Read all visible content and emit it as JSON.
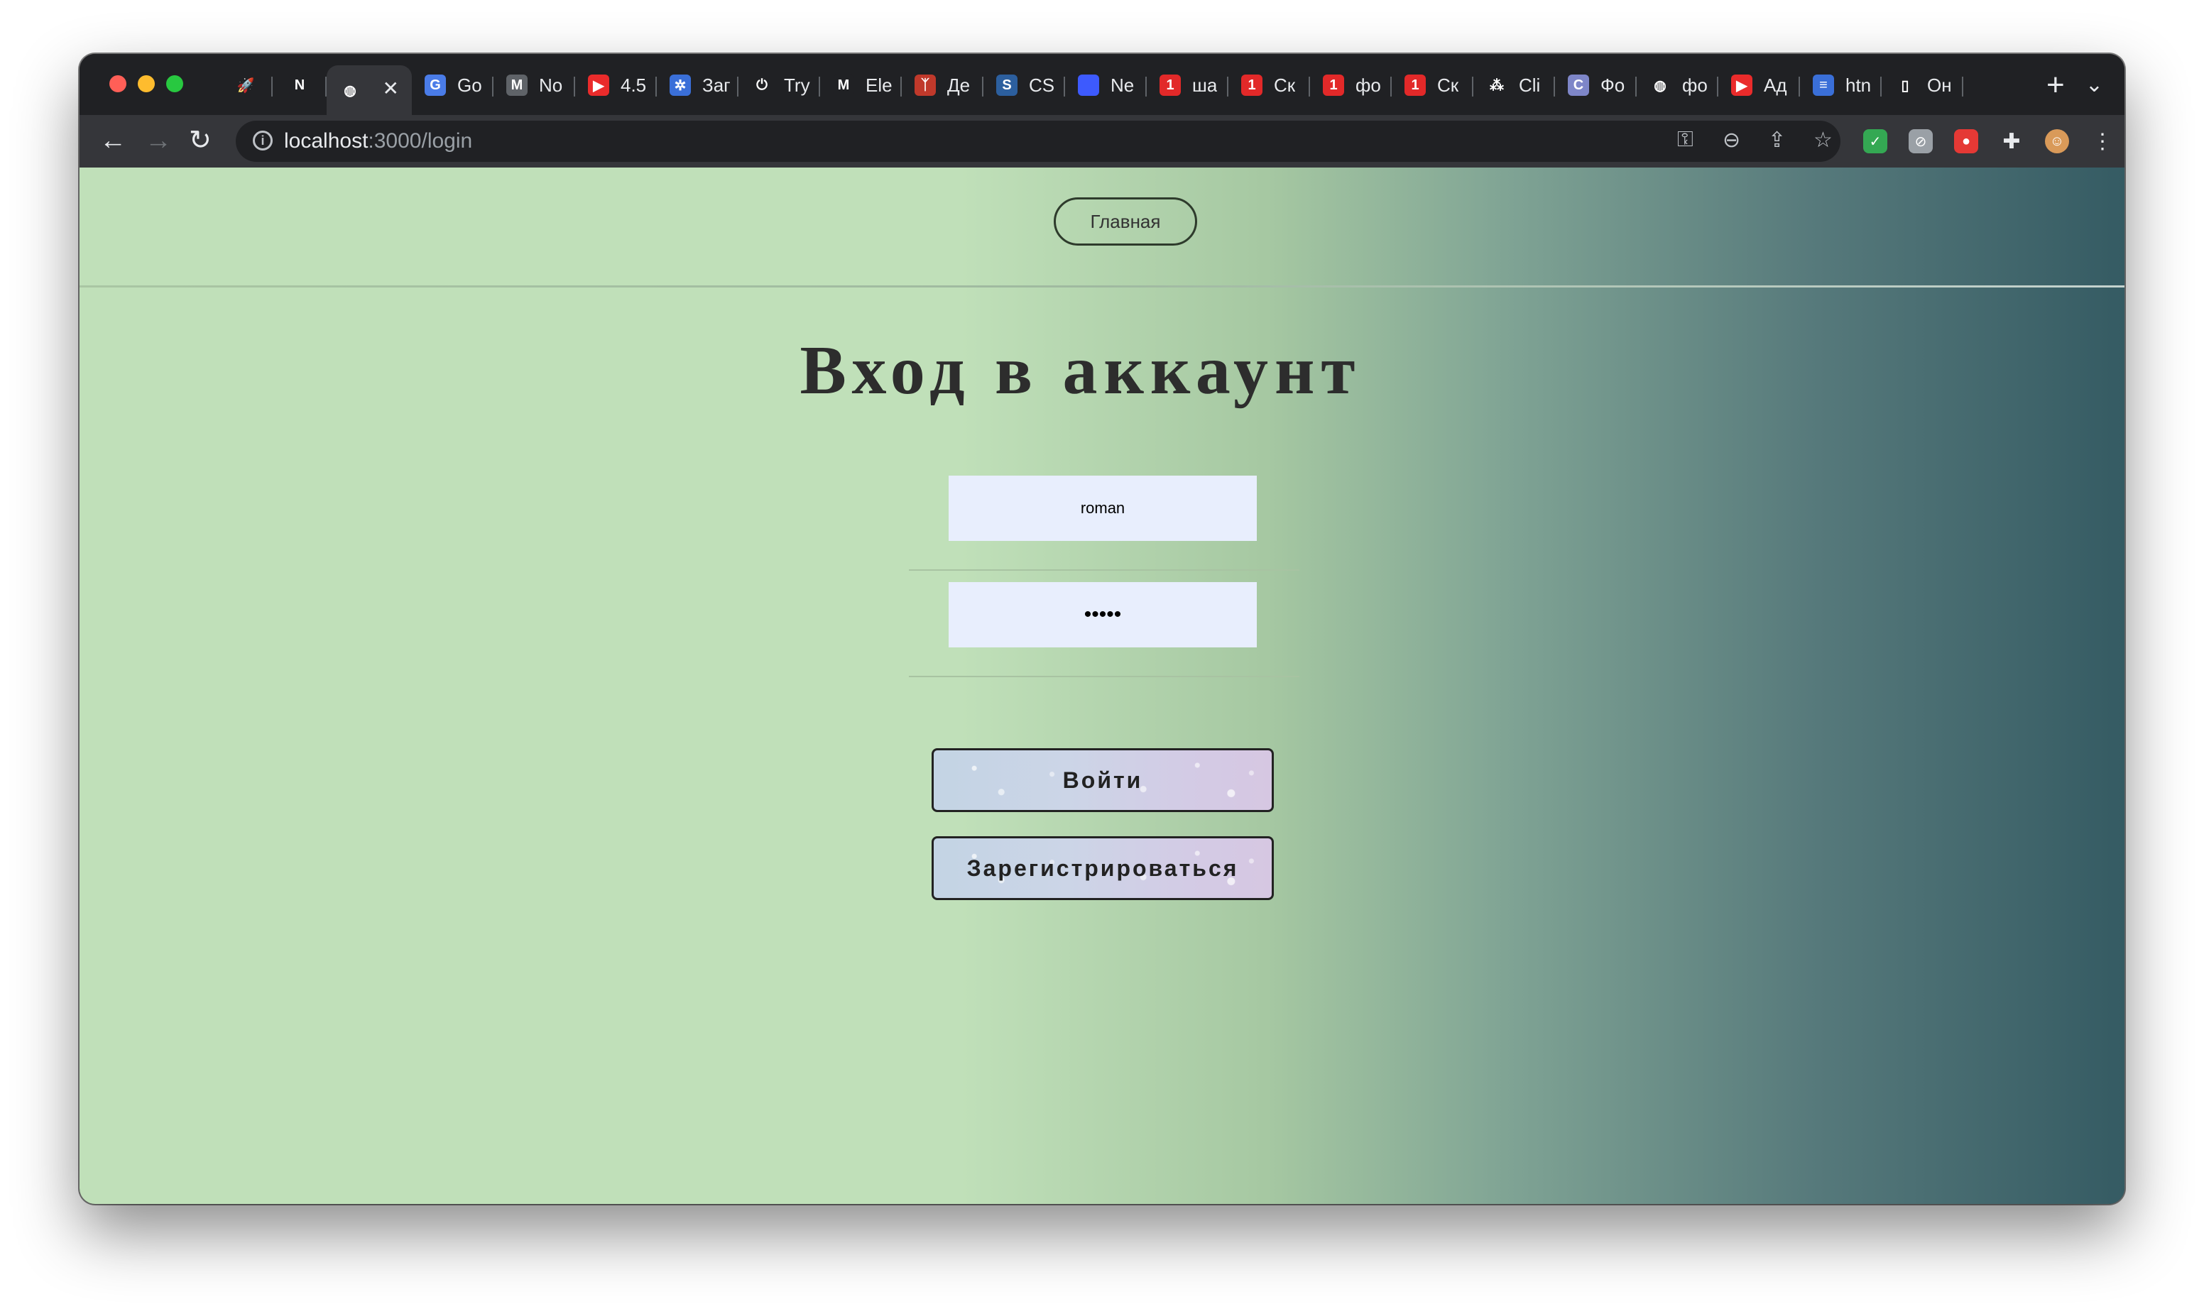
{
  "browser": {
    "tabs": [
      {
        "title": "",
        "icon": "rocket-icon",
        "glyph": "🚀",
        "color": "transparent"
      },
      {
        "title": "",
        "icon": "notion-icon",
        "glyph": "N",
        "color": "#202124"
      },
      {
        "title": "",
        "icon": "globe-icon",
        "glyph": "◍",
        "color": "transparent",
        "active": true
      },
      {
        "title": "Go",
        "icon": "translate-icon",
        "glyph": "G",
        "color": "#4a7ce8"
      },
      {
        "title": "No",
        "icon": "gmail-icon",
        "glyph": "M",
        "color": "#5f6368"
      },
      {
        "title": "4.5",
        "icon": "youtube-icon",
        "glyph": "▶",
        "color": "#ea2b2b"
      },
      {
        "title": "Заг",
        "icon": "gear-blue-icon",
        "glyph": "✲",
        "color": "#3a6fd8"
      },
      {
        "title": "Try",
        "icon": "power-icon",
        "glyph": "⏻",
        "color": "transparent"
      },
      {
        "title": "Ele",
        "icon": "m-logo-icon",
        "glyph": "M",
        "color": "#202124"
      },
      {
        "title": "Де",
        "icon": "figure-icon",
        "glyph": "ᛉ",
        "color": "#c0392b"
      },
      {
        "title": "CS",
        "icon": "css-icon",
        "glyph": "S",
        "color": "#2c5f9e"
      },
      {
        "title": "Ne",
        "icon": "blue-square-icon",
        "glyph": "",
        "color": "#3d5afe"
      },
      {
        "title": "ша",
        "icon": "one-red-icon",
        "glyph": "1",
        "color": "#e22929"
      },
      {
        "title": "Ск",
        "icon": "one-red-icon",
        "glyph": "1",
        "color": "#e22929"
      },
      {
        "title": "фо",
        "icon": "one-red-icon",
        "glyph": "1",
        "color": "#e22929"
      },
      {
        "title": "Ск",
        "icon": "one-red-icon",
        "glyph": "1",
        "color": "#e22929"
      },
      {
        "title": "Cli",
        "icon": "dots-icon",
        "glyph": "⁂",
        "color": "transparent"
      },
      {
        "title": "Фо",
        "icon": "c-logo-icon",
        "glyph": "C",
        "color": "#7e86c8"
      },
      {
        "title": "фо",
        "icon": "globe-icon",
        "glyph": "◍",
        "color": "transparent"
      },
      {
        "title": "Ад",
        "icon": "youtube-icon",
        "glyph": "▶",
        "color": "#ea2b2b"
      },
      {
        "title": "htn",
        "icon": "stack-icon",
        "glyph": "≡",
        "color": "#3a6fd8"
      },
      {
        "title": "Он",
        "icon": "phone-icon",
        "glyph": "▯",
        "color": "transparent"
      }
    ],
    "close_glyph": "✕",
    "new_tab_glyph": "+",
    "tab_menu_glyph": "⌄",
    "nav": {
      "back": "←",
      "forward": "→",
      "reload": "↻"
    },
    "url_host": "localhost",
    "url_rest": ":3000/login",
    "info_glyph": "i",
    "omni_icons": {
      "key": "⚿",
      "zoom": "⊖",
      "share": "⇪",
      "star": "☆"
    },
    "extensions": [
      {
        "name": "shield-extension-icon",
        "glyph": "✓",
        "color": "#34a853"
      },
      {
        "name": "compass-extension-icon",
        "glyph": "⊘",
        "color": "#9aa0a6"
      },
      {
        "name": "red-extension-icon",
        "glyph": "●",
        "color": "#e53935"
      },
      {
        "name": "puzzle-icon",
        "glyph": "✚",
        "color": "transparent"
      },
      {
        "name": "avatar",
        "glyph": "☺",
        "color": "#d99a59"
      },
      {
        "name": "more-menu-icon",
        "glyph": "⋮",
        "color": "transparent"
      }
    ]
  },
  "page": {
    "home_label": "Главная",
    "title": "Вход в аккаунт",
    "login_value": "roman",
    "password_masked": "•••••",
    "signin_label": "Войти",
    "signup_label": "Зарегистрироваться"
  },
  "colors": {
    "page_gradient_start": "#c0e0b9",
    "page_gradient_end": "#355b63",
    "input_bg": "#e8eefd",
    "button_gradient": "#ccd5e7"
  }
}
